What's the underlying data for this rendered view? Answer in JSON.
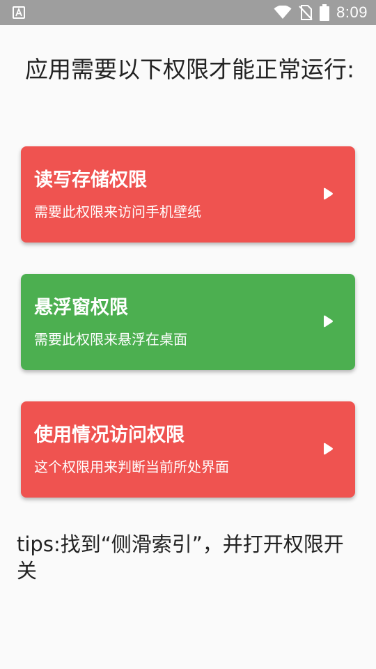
{
  "status_bar": {
    "time": "8:09",
    "notification_icon": "a-letter-icon",
    "icons": [
      "wifi-icon",
      "no-sim-icon",
      "battery-icon"
    ]
  },
  "page": {
    "title": "应用需要以下权限才能正常运行:"
  },
  "permissions": [
    {
      "title": "读写存储权限",
      "description": "需要此权限来访问手机壁纸",
      "color": "#ef5350",
      "state": "not-granted",
      "icon": "play-arrow-icon"
    },
    {
      "title": "悬浮窗权限",
      "description": "需要此权限来悬浮在桌面",
      "color": "#4caf50",
      "state": "granted",
      "icon": "play-arrow-icon"
    },
    {
      "title": "使用情况访问权限",
      "description": "这个权限用来判断当前所处界面",
      "color": "#ef5350",
      "state": "not-granted",
      "icon": "play-arrow-icon"
    }
  ],
  "tips": "tips:找到“侧滑索引”，并打开权限开关",
  "colors": {
    "status_bar": "#9e9e9e",
    "background": "#fafafa",
    "text": "#222222",
    "denied": "#ef5350",
    "granted": "#4caf50"
  }
}
